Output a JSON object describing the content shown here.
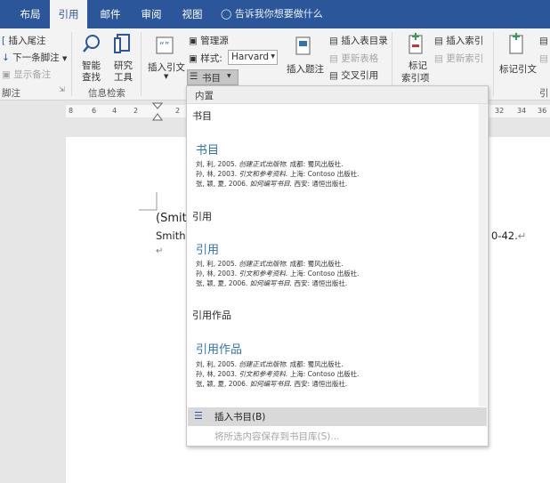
{
  "ribbon_tabs": [
    "布局",
    "引用",
    "邮件",
    "审阅",
    "视图"
  ],
  "tell_me": "告诉我你想要做什么",
  "footnotes": {
    "insert_endnote": "插入尾注",
    "next_footnote": "下一条脚注",
    "show_notes": "显示备注",
    "group": "脚注"
  },
  "research": {
    "smart_lookup": [
      "智能",
      "查找"
    ],
    "researcher": [
      "研究",
      "工具"
    ],
    "group": "信息检索"
  },
  "citations": {
    "insert_citation": "插入引文",
    "manage_sources": "管理源",
    "style_label": "样式:",
    "style_value": "Harvard",
    "bibliography": "书目"
  },
  "captions": {
    "insert_caption": "插入题注",
    "insert_table_of_figures": "插入表目录",
    "update_table": "更新表格",
    "cross_reference": "交叉引用"
  },
  "index": {
    "mark_entry": [
      "标记",
      "索引项"
    ],
    "insert_index": "插入索引",
    "update_index": "更新索引"
  },
  "authorities": {
    "mark_citation": "标记引文",
    "group_partial": "引"
  },
  "ruler_numbers": [
    "8",
    "6",
    "4",
    "2",
    "2",
    "32",
    "34",
    "36"
  ],
  "document": {
    "line1": "(Smit",
    "line2": "Smith,",
    "line2_end": "0-42.",
    "return_mark": "↵"
  },
  "gallery": {
    "header": "内置",
    "sections": [
      {
        "label": "书目",
        "title": "书目",
        "refs": [
          {
            "author": "刘, 利, 2005.",
            "work": "创建正式出版物.",
            "place": "成都: 蜀风出版社."
          },
          {
            "author": "孙, 林, 2003.",
            "work": "引文和参考资料.",
            "place": "上海: Contoso 出版社."
          },
          {
            "author": "张, 颖, 夏, 2006.",
            "work": "如何编写书目.",
            "place": "西安: 通恒出版社."
          }
        ]
      },
      {
        "label": "引用",
        "title": "引用",
        "refs": [
          {
            "author": "刘, 利, 2005.",
            "work": "创建正式出版物.",
            "place": "成都: 蜀风出版社."
          },
          {
            "author": "孙, 林, 2003.",
            "work": "引文和参考资料.",
            "place": "上海: Contoso 出版社."
          },
          {
            "author": "张, 颖, 夏, 2006.",
            "work": "如何编写书目.",
            "place": "西安: 通恒出版社."
          }
        ]
      },
      {
        "label": "引用作品",
        "title": "引用作品",
        "refs": [
          {
            "author": "刘, 利, 2005.",
            "work": "创建正式出版物.",
            "place": "成都: 蜀风出版社."
          },
          {
            "author": "孙, 林, 2003.",
            "work": "引文和参考资料.",
            "place": "上海: Contoso 出版社."
          },
          {
            "author": "张, 颖, 夏, 2006.",
            "work": "如何编写书目.",
            "place": "西安: 通恒出版社."
          }
        ]
      }
    ],
    "insert_bibliography": "插入书目(B)",
    "save_selection": "将所选内容保存到书目库(S)..."
  },
  "colors": {
    "tab_bar": "#2b579a",
    "ribbon": "#f3f3f3",
    "entry_title": "#2e74b5",
    "hover": "#d9d9d9"
  }
}
